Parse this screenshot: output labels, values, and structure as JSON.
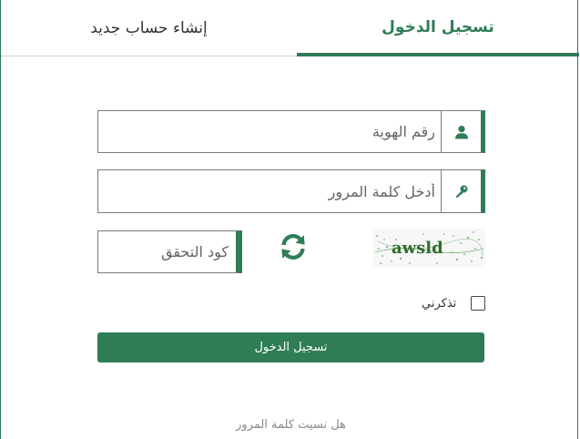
{
  "tabs": {
    "login_label": "تسجيل الدخول",
    "register_label": "إنشاء حساب جديد"
  },
  "form": {
    "id_placeholder": "رقم الهوية",
    "password_placeholder": "أدخل كلمة المرور",
    "captcha_placeholder": "كود التحقق",
    "captcha_image_text": "awsld",
    "remember_label": "تذكرني",
    "remember_checked": false,
    "submit_label": "تسجيل الدخول",
    "forgot_label": "هل نسيت كلمة المرور"
  },
  "colors": {
    "accent": "#2f7d55",
    "border": "#7a7a7a",
    "muted_text": "#8a8a8a"
  },
  "icons": {
    "id_field": "user-icon",
    "password_field": "key-icon",
    "captcha_refresh": "refresh-icon"
  }
}
